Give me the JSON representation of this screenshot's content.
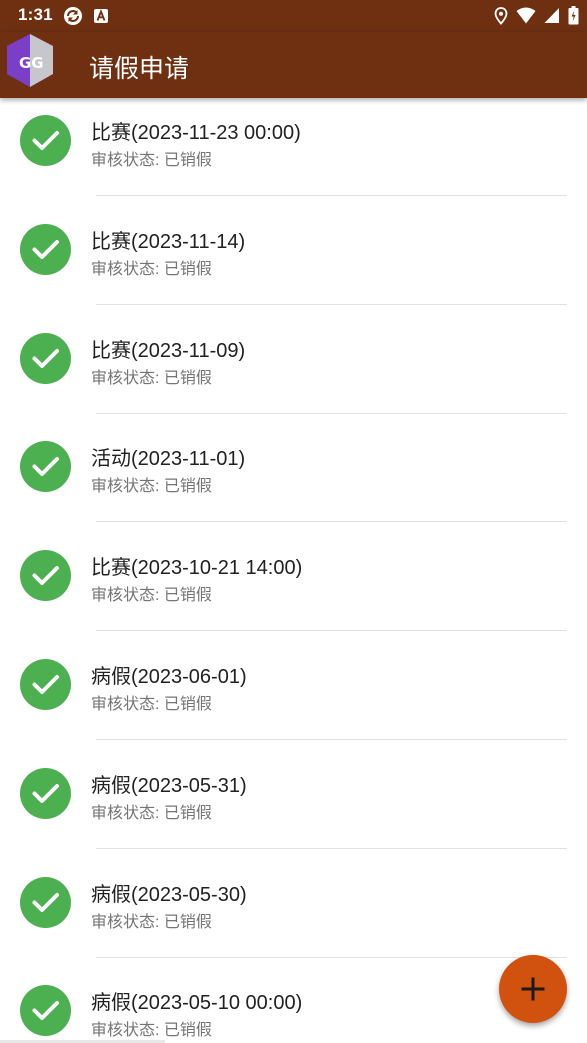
{
  "status_bar": {
    "time": "1:31"
  },
  "app_bar": {
    "title": "请假申请",
    "logo_text": "GG"
  },
  "leave_list": {
    "items": [
      {
        "title": "比赛(2023-11-23 00:00)",
        "status": "审核状态: 已销假"
      },
      {
        "title": "比赛(2023-11-14)",
        "status": "审核状态: 已销假"
      },
      {
        "title": "比赛(2023-11-09)",
        "status": "审核状态: 已销假"
      },
      {
        "title": "活动(2023-11-01)",
        "status": "审核状态: 已销假"
      },
      {
        "title": "比赛(2023-10-21 14:00)",
        "status": "审核状态: 已销假"
      },
      {
        "title": "病假(2023-06-01)",
        "status": "审核状态: 已销假"
      },
      {
        "title": "病假(2023-05-31)",
        "status": "审核状态: 已销假"
      },
      {
        "title": "病假(2023-05-30)",
        "status": "审核状态: 已销假"
      },
      {
        "title": "病假(2023-05-10 00:00)",
        "status": "审核状态: 已销假"
      }
    ]
  },
  "icons": {
    "status_left": [
      "sync-icon",
      "a-icon"
    ],
    "status_right": [
      "location-icon",
      "wifi-icon",
      "signal-icon",
      "battery-icon"
    ],
    "item": "check-circle-icon",
    "fab": "plus-icon"
  },
  "colors": {
    "app_bar": "#6e3011",
    "check": "#4caf50",
    "fab": "#d1510f"
  }
}
